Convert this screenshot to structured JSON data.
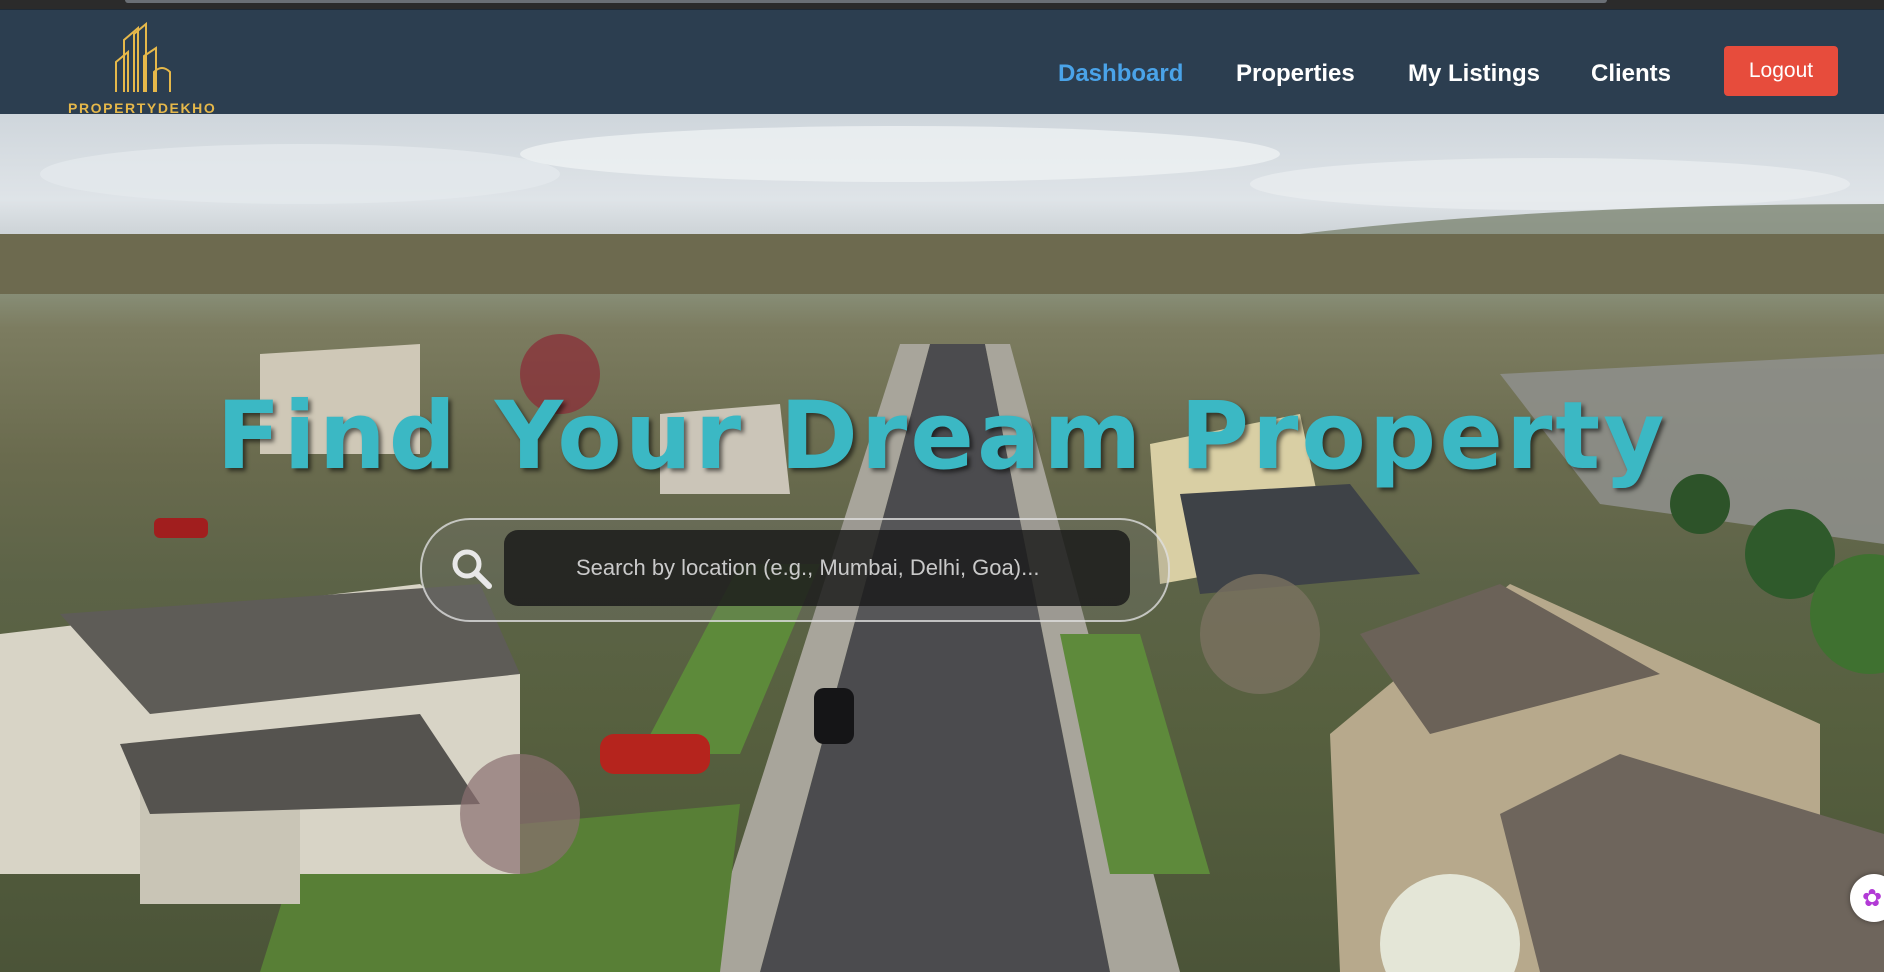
{
  "brand": {
    "name": "PROPERTYDEKHO"
  },
  "nav": {
    "items": [
      {
        "label": "Dashboard",
        "active": true
      },
      {
        "label": "Properties",
        "active": false
      },
      {
        "label": "My Listings",
        "active": false
      },
      {
        "label": "Clients",
        "active": false
      }
    ],
    "logout_label": "Logout"
  },
  "hero": {
    "title": "Find Your Dream Property",
    "search": {
      "placeholder": "Search by location (e.g., Mumbai, Delhi, Goa)...",
      "value": ""
    }
  },
  "colors": {
    "navbar": "#2c3e50",
    "active_nav": "#4aa3e8",
    "logout": "#e74c3c",
    "hero_title": "#3bb8c4",
    "brand_gold": "#e6b84a"
  },
  "icons": [
    "building-logo-icon",
    "search-icon",
    "chat-assistant-icon"
  ]
}
